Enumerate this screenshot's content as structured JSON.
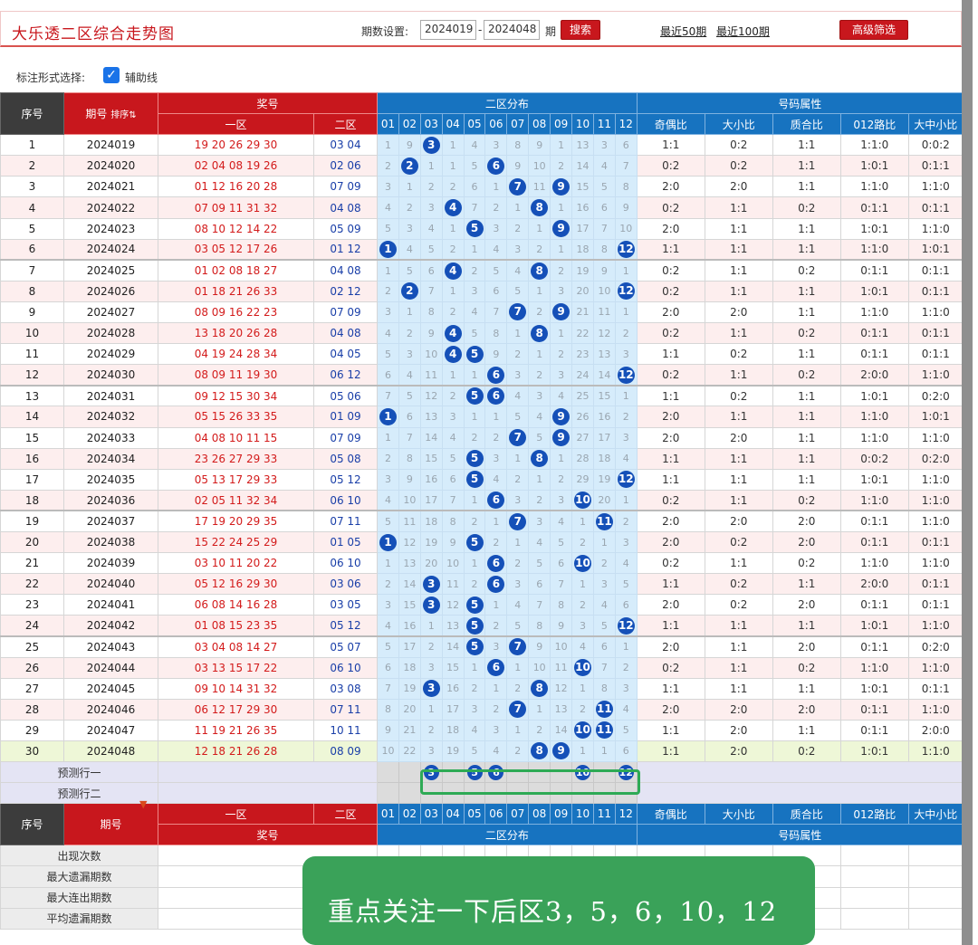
{
  "header": {
    "title": "大乐透二区综合走势图",
    "period_label": "期数设置:",
    "period_from": "2024019",
    "period_sep": "-",
    "period_to": "2024048",
    "period_unit": "期",
    "search_label": "搜索",
    "recent50_label": "最近50期",
    "recent100_label": "最近100期",
    "advanced_label": "高级筛选"
  },
  "marker": {
    "label": "标注形式选择:",
    "checkbox_label": "辅助线",
    "checked": true
  },
  "table_header": {
    "seq": "序号",
    "issue": "期号",
    "sort": "排序",
    "prize": "奖号",
    "zone1": "一区",
    "zone2": "二区",
    "dist": "二区分布",
    "attr": "号码属性",
    "cols": [
      "01",
      "02",
      "03",
      "04",
      "05",
      "06",
      "07",
      "08",
      "09",
      "10",
      "11",
      "12"
    ],
    "attr_cols": [
      "奇偶比",
      "大小比",
      "质合比",
      "012路比",
      "大中小比"
    ]
  },
  "rows": [
    {
      "seq": "1",
      "issue": "2024019",
      "front": "19 20 26 29 30",
      "back": "03 04",
      "dist": [
        1,
        9,
        "B",
        1,
        4,
        3,
        8,
        9,
        1,
        13,
        3,
        6
      ],
      "attrs": [
        "1:1",
        "0:2",
        "1:1",
        "1:1:0",
        "0:0:2"
      ]
    },
    {
      "seq": "2",
      "issue": "2024020",
      "front": "02 04 08 19 26",
      "back": "02 06",
      "dist": [
        2,
        "B",
        1,
        1,
        5,
        "B",
        9,
        10,
        2,
        14,
        4,
        7
      ],
      "attrs": [
        "0:2",
        "0:2",
        "1:1",
        "1:0:1",
        "0:1:1"
      ]
    },
    {
      "seq": "3",
      "issue": "2024021",
      "front": "01 12 16 20 28",
      "back": "07 09",
      "dist": [
        3,
        1,
        2,
        2,
        6,
        1,
        "B",
        11,
        "B",
        15,
        5,
        8
      ],
      "attrs": [
        "2:0",
        "2:0",
        "1:1",
        "1:1:0",
        "1:1:0"
      ]
    },
    {
      "seq": "4",
      "issue": "2024022",
      "front": "07 09 11 31 32",
      "back": "04 08",
      "dist": [
        4,
        2,
        3,
        "B",
        7,
        2,
        1,
        "B",
        1,
        16,
        6,
        9
      ],
      "attrs": [
        "0:2",
        "1:1",
        "0:2",
        "0:1:1",
        "0:1:1"
      ]
    },
    {
      "seq": "5",
      "issue": "2024023",
      "front": "08 10 12 14 22",
      "back": "05 09",
      "dist": [
        5,
        3,
        4,
        1,
        "B",
        3,
        2,
        1,
        "B",
        17,
        7,
        10
      ],
      "attrs": [
        "2:0",
        "1:1",
        "1:1",
        "1:0:1",
        "1:1:0"
      ]
    },
    {
      "seq": "6",
      "issue": "2024024",
      "front": "03 05 12 17 26",
      "back": "01 12",
      "dist": [
        "B",
        4,
        5,
        2,
        1,
        4,
        3,
        2,
        1,
        18,
        8,
        "B"
      ],
      "attrs": [
        "1:1",
        "1:1",
        "1:1",
        "1:1:0",
        "1:0:1"
      ]
    },
    {
      "seq": "7",
      "issue": "2024025",
      "front": "01 02 08 18 27",
      "back": "04 08",
      "dist": [
        1,
        5,
        6,
        "B",
        2,
        5,
        4,
        "B",
        2,
        19,
        9,
        1
      ],
      "attrs": [
        "0:2",
        "1:1",
        "0:2",
        "0:1:1",
        "0:1:1"
      ]
    },
    {
      "seq": "8",
      "issue": "2024026",
      "front": "01 18 21 26 33",
      "back": "02 12",
      "dist": [
        2,
        "B",
        7,
        1,
        3,
        6,
        5,
        1,
        3,
        20,
        10,
        "B"
      ],
      "attrs": [
        "0:2",
        "1:1",
        "1:1",
        "1:0:1",
        "0:1:1"
      ]
    },
    {
      "seq": "9",
      "issue": "2024027",
      "front": "08 09 16 22 23",
      "back": "07 09",
      "dist": [
        3,
        1,
        8,
        2,
        4,
        7,
        "B",
        2,
        "B",
        21,
        11,
        1
      ],
      "attrs": [
        "2:0",
        "2:0",
        "1:1",
        "1:1:0",
        "1:1:0"
      ]
    },
    {
      "seq": "10",
      "issue": "2024028",
      "front": "13 18 20 26 28",
      "back": "04 08",
      "dist": [
        4,
        2,
        9,
        "B",
        5,
        8,
        1,
        "B",
        1,
        22,
        12,
        2
      ],
      "attrs": [
        "0:2",
        "1:1",
        "0:2",
        "0:1:1",
        "0:1:1"
      ]
    },
    {
      "seq": "11",
      "issue": "2024029",
      "front": "04 19 24 28 34",
      "back": "04 05",
      "dist": [
        5,
        3,
        10,
        "B",
        "B",
        9,
        2,
        1,
        2,
        23,
        13,
        3
      ],
      "attrs": [
        "1:1",
        "0:2",
        "1:1",
        "0:1:1",
        "0:1:1"
      ]
    },
    {
      "seq": "12",
      "issue": "2024030",
      "front": "08 09 11 19 30",
      "back": "06 12",
      "dist": [
        6,
        4,
        11,
        1,
        1,
        "B",
        3,
        2,
        3,
        24,
        14,
        "B"
      ],
      "attrs": [
        "0:2",
        "1:1",
        "0:2",
        "2:0:0",
        "1:1:0"
      ]
    },
    {
      "seq": "13",
      "issue": "2024031",
      "front": "09 12 15 30 34",
      "back": "05 06",
      "dist": [
        7,
        5,
        12,
        2,
        "B",
        "B",
        4,
        3,
        4,
        25,
        15,
        1
      ],
      "attrs": [
        "1:1",
        "0:2",
        "1:1",
        "1:0:1",
        "0:2:0"
      ]
    },
    {
      "seq": "14",
      "issue": "2024032",
      "front": "05 15 26 33 35",
      "back": "01 09",
      "dist": [
        "B",
        6,
        13,
        3,
        1,
        1,
        5,
        4,
        "B",
        26,
        16,
        2
      ],
      "attrs": [
        "2:0",
        "1:1",
        "1:1",
        "1:1:0",
        "1:0:1"
      ]
    },
    {
      "seq": "15",
      "issue": "2024033",
      "front": "04 08 10 11 15",
      "back": "07 09",
      "dist": [
        1,
        7,
        14,
        4,
        2,
        2,
        "B",
        5,
        "B",
        27,
        17,
        3
      ],
      "attrs": [
        "2:0",
        "2:0",
        "1:1",
        "1:1:0",
        "1:1:0"
      ]
    },
    {
      "seq": "16",
      "issue": "2024034",
      "front": "23 26 27 29 33",
      "back": "05 08",
      "dist": [
        2,
        8,
        15,
        5,
        "B",
        3,
        1,
        "B",
        1,
        28,
        18,
        4
      ],
      "attrs": [
        "1:1",
        "1:1",
        "1:1",
        "0:0:2",
        "0:2:0"
      ]
    },
    {
      "seq": "17",
      "issue": "2024035",
      "front": "05 13 17 29 33",
      "back": "05 12",
      "dist": [
        3,
        9,
        16,
        6,
        "B",
        4,
        2,
        1,
        2,
        29,
        19,
        "B"
      ],
      "attrs": [
        "1:1",
        "1:1",
        "1:1",
        "1:0:1",
        "1:1:0"
      ]
    },
    {
      "seq": "18",
      "issue": "2024036",
      "front": "02 05 11 32 34",
      "back": "06 10",
      "dist": [
        4,
        10,
        17,
        7,
        1,
        "B",
        3,
        2,
        3,
        "B",
        20,
        1
      ],
      "attrs": [
        "0:2",
        "1:1",
        "0:2",
        "1:1:0",
        "1:1:0"
      ]
    },
    {
      "seq": "19",
      "issue": "2024037",
      "front": "17 19 20 29 35",
      "back": "07 11",
      "dist": [
        5,
        11,
        18,
        8,
        2,
        1,
        "B",
        3,
        4,
        1,
        "B",
        2
      ],
      "attrs": [
        "2:0",
        "2:0",
        "2:0",
        "0:1:1",
        "1:1:0"
      ]
    },
    {
      "seq": "20",
      "issue": "2024038",
      "front": "15 22 24 25 29",
      "back": "01 05",
      "dist": [
        "B",
        12,
        19,
        9,
        "B",
        2,
        1,
        4,
        5,
        2,
        1,
        3
      ],
      "attrs": [
        "2:0",
        "0:2",
        "2:0",
        "0:1:1",
        "0:1:1"
      ]
    },
    {
      "seq": "21",
      "issue": "2024039",
      "front": "03 10 11 20 22",
      "back": "06 10",
      "dist": [
        1,
        13,
        20,
        10,
        1,
        "B",
        2,
        5,
        6,
        "B",
        2,
        4
      ],
      "attrs": [
        "0:2",
        "1:1",
        "0:2",
        "1:1:0",
        "1:1:0"
      ]
    },
    {
      "seq": "22",
      "issue": "2024040",
      "front": "05 12 16 29 30",
      "back": "03 06",
      "dist": [
        2,
        14,
        "B",
        11,
        2,
        "B",
        3,
        6,
        7,
        1,
        3,
        5
      ],
      "attrs": [
        "1:1",
        "0:2",
        "1:1",
        "2:0:0",
        "0:1:1"
      ]
    },
    {
      "seq": "23",
      "issue": "2024041",
      "front": "06 08 14 16 28",
      "back": "03 05",
      "dist": [
        3,
        15,
        "B",
        12,
        "B",
        1,
        4,
        7,
        8,
        2,
        4,
        6
      ],
      "attrs": [
        "2:0",
        "0:2",
        "2:0",
        "0:1:1",
        "0:1:1"
      ]
    },
    {
      "seq": "24",
      "issue": "2024042",
      "front": "01 08 15 23 35",
      "back": "05 12",
      "dist": [
        4,
        16,
        1,
        13,
        "B",
        2,
        5,
        8,
        9,
        3,
        5,
        "B"
      ],
      "attrs": [
        "1:1",
        "1:1",
        "1:1",
        "1:0:1",
        "1:1:0"
      ]
    },
    {
      "seq": "25",
      "issue": "2024043",
      "front": "03 04 08 14 27",
      "back": "05 07",
      "dist": [
        5,
        17,
        2,
        14,
        "B",
        3,
        "B",
        9,
        10,
        4,
        6,
        1
      ],
      "attrs": [
        "2:0",
        "1:1",
        "2:0",
        "0:1:1",
        "0:2:0"
      ]
    },
    {
      "seq": "26",
      "issue": "2024044",
      "front": "03 13 15 17 22",
      "back": "06 10",
      "dist": [
        6,
        18,
        3,
        15,
        1,
        "B",
        1,
        10,
        11,
        "B",
        7,
        2
      ],
      "attrs": [
        "0:2",
        "1:1",
        "0:2",
        "1:1:0",
        "1:1:0"
      ]
    },
    {
      "seq": "27",
      "issue": "2024045",
      "front": "09 10 14 31 32",
      "back": "03 08",
      "dist": [
        7,
        19,
        "B",
        16,
        2,
        1,
        2,
        "B",
        12,
        1,
        8,
        3
      ],
      "attrs": [
        "1:1",
        "1:1",
        "1:1",
        "1:0:1",
        "0:1:1"
      ]
    },
    {
      "seq": "28",
      "issue": "2024046",
      "front": "06 12 17 29 30",
      "back": "07 11",
      "dist": [
        8,
        20,
        1,
        17,
        3,
        2,
        "B",
        1,
        13,
        2,
        "B",
        4
      ],
      "attrs": [
        "2:0",
        "2:0",
        "2:0",
        "0:1:1",
        "1:1:0"
      ]
    },
    {
      "seq": "29",
      "issue": "2024047",
      "front": "11 19 21 26 35",
      "back": "10 11",
      "dist": [
        9,
        21,
        2,
        18,
        4,
        3,
        1,
        2,
        14,
        "B",
        "B",
        5
      ],
      "attrs": [
        "1:1",
        "2:0",
        "1:1",
        "0:1:1",
        "2:0:0"
      ]
    },
    {
      "seq": "30",
      "issue": "2024048",
      "front": "12 18 21 26 28",
      "back": "08 09",
      "dist": [
        10,
        22,
        3,
        19,
        5,
        4,
        2,
        "B",
        "B",
        1,
        1,
        6
      ],
      "attrs": [
        "1:1",
        "2:0",
        "0:2",
        "1:0:1",
        "1:1:0"
      ]
    }
  ],
  "predict": {
    "row1_label": "预测行一",
    "row2_label": "预测行二",
    "row1_balls": [
      "3",
      "",
      "5",
      "6",
      "",
      "",
      "",
      "10",
      "",
      "12"
    ]
  },
  "footer_header": {
    "seq": "序号",
    "issue": "期号",
    "zone1": "一区",
    "zone2": "二区",
    "prize": "奖号",
    "dist": "二区分布",
    "attr": "号码属性"
  },
  "stats": [
    "出现次数",
    "最大遗漏期数",
    "最大连出期数",
    "平均遗漏期数"
  ],
  "callout": "重点关注一下后区3，5，6，10，12",
  "colors": {
    "red": "#c8171d",
    "blue": "#1773c0",
    "ball": "#1550b8",
    "green": "#3aa259"
  }
}
